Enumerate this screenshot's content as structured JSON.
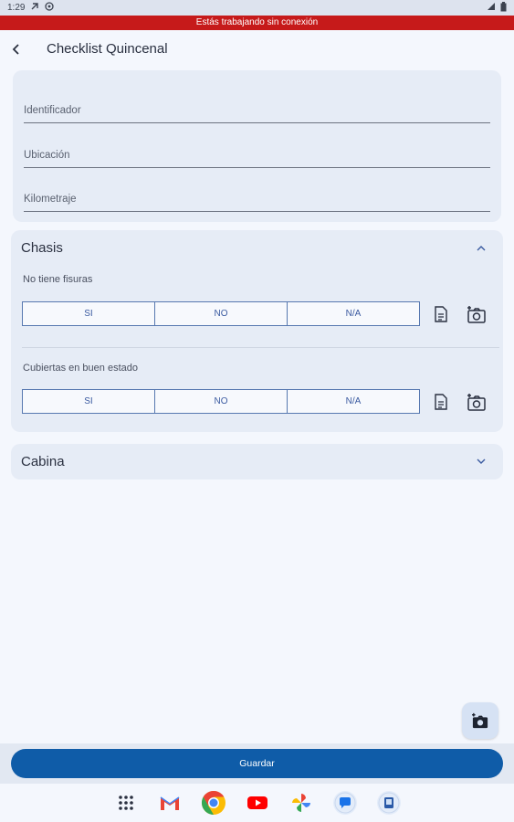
{
  "status_bar": {
    "time": "1:29"
  },
  "offline_banner": "Estás trabajando sin conexión",
  "header": {
    "title": "Checklist Quincenal"
  },
  "form": {
    "fields": [
      {
        "label": "Identificador",
        "value": ""
      },
      {
        "label": "Ubicación",
        "value": ""
      },
      {
        "label": "Kilometraje",
        "value": ""
      }
    ]
  },
  "sections": {
    "chasis": {
      "title": "Chasis",
      "expanded": true,
      "questions": [
        {
          "label": "No tiene fisuras",
          "options": [
            "SI",
            "NO",
            "N/A"
          ]
        },
        {
          "label": "Cubiertas en buen estado",
          "options": [
            "SI",
            "NO",
            "N/A"
          ]
        }
      ]
    },
    "cabina": {
      "title": "Cabina",
      "expanded": false
    }
  },
  "actions": {
    "save_label": "Guardar"
  },
  "dock_apps": [
    "apps-grid-icon",
    "gmail-icon",
    "chrome-icon",
    "youtube-icon",
    "photos-icon",
    "messages-icon",
    "app-shortcut-icon"
  ],
  "colors": {
    "offline": "#c61a1a",
    "primary": "#0f5ca8",
    "accent": "#5778b0"
  }
}
